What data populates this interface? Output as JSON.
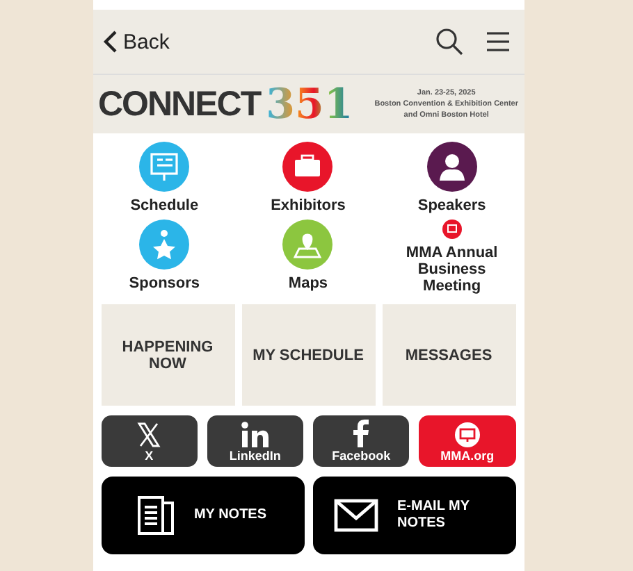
{
  "nav": {
    "back": "Back"
  },
  "banner": {
    "logo_word": "CONNECT",
    "logo_number": "351",
    "dates": "Jan. 23-25, 2025",
    "venue_lines": [
      "Boston Convention & Exhibition Center",
      "and Omni Boston Hotel"
    ]
  },
  "menu": [
    {
      "label": "Schedule",
      "kind": "presentation",
      "color": "#2bb5e8"
    },
    {
      "label": "Exhibitors",
      "kind": "briefcase",
      "color": "#e8152a"
    },
    {
      "label": "Speakers",
      "kind": "person",
      "color": "#5a1a4f"
    },
    {
      "label": "Sponsors",
      "kind": "star",
      "color": "#2bb5e8"
    },
    {
      "label": "Maps",
      "kind": "map",
      "color": "#8cc63f"
    },
    {
      "label": "MMA Annual Business Meeting",
      "kind": "small",
      "color": "#e8152a"
    }
  ],
  "tiles": [
    "HAPPENING NOW",
    "MY SCHEDULE",
    "MESSAGES"
  ],
  "social": [
    {
      "label": "X",
      "kind": "x",
      "color": "#3a3a3a"
    },
    {
      "label": "LinkedIn",
      "kind": "linkedin",
      "color": "#3a3a3a"
    },
    {
      "label": "Facebook",
      "kind": "facebook",
      "color": "#3a3a3a"
    },
    {
      "label": "MMA.org",
      "kind": "web",
      "color": "#e8152a"
    }
  ],
  "actions": [
    {
      "label": "MY NOTES",
      "kind": "notes"
    },
    {
      "label": "E-MAIL MY NOTES",
      "kind": "mail"
    }
  ]
}
